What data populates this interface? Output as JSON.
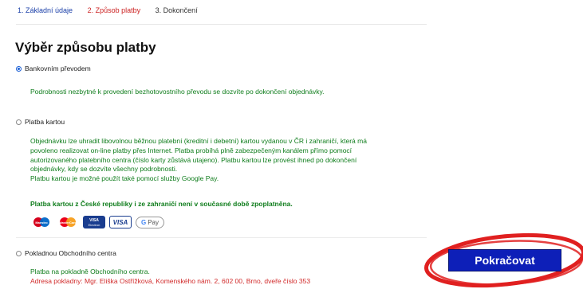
{
  "steps": [
    {
      "label": "1. Základní údaje"
    },
    {
      "label": "2. Způsob platby"
    },
    {
      "label": "3. Dokončení"
    }
  ],
  "title": "Výběr způsobu platby",
  "options": {
    "bank": {
      "label": "Bankovním převodem",
      "selected": true,
      "note": "Podrobnosti nezbytné k provedení bezhotovostního převodu se dozvíte po dokončení objednávky."
    },
    "card": {
      "label": "Platba kartou",
      "selected": false,
      "desc_lines": [
        "Objednávku lze uhradit libovolnou běžnou platební (kreditní i debetní) kartou vydanou v ČR i zahraničí, která má",
        "povoleno realizovat on-line platby přes Internet. Platba probíhá plně zabezpečeným kanálem přímo pomocí",
        "autorizovaného platebního centra (číslo karty zůstává utajeno). Platbu kartou lze provést ihned po dokončení",
        "objednávky, kdy se dozvíte všechny podrobnosti.",
        "Platbu kartou je možné použít také pomocí služby Google Pay."
      ],
      "fee_note": "Platba kartou z České republiky i ze zahraničí není v současné době zpoplatněna.",
      "logos": {
        "maestro": "Maestro",
        "mastercard": "MasterCard",
        "visa_electron": {
          "top": "VISA",
          "bottom": "Electron"
        },
        "visa": "VISA",
        "gpay": {
          "g": "G",
          "text": "Pay"
        }
      }
    },
    "cashier": {
      "label": "Pokladnou Obchodního centra",
      "selected": false,
      "line1": "Platba na pokladně Obchodního centra.",
      "line2": "Adresa pokladny: Mgr. Eliška Ostřížková, Komenského nám. 2, 602 00, Brno, dveře číslo 353"
    }
  },
  "continue_button": "Pokračovat",
  "colors": {
    "accent": "#0d1fb8",
    "annotation": "#e02020",
    "note_green": "#0f7d1c",
    "active_step": "#cc2222"
  }
}
